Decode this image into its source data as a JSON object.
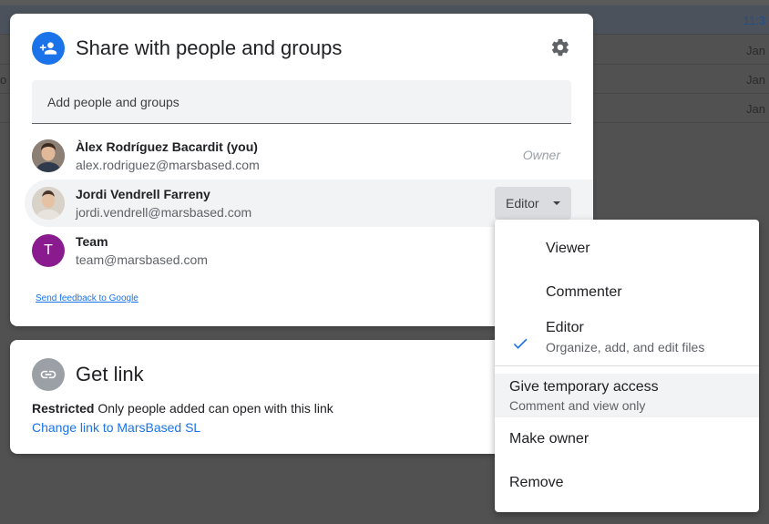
{
  "background": {
    "times": [
      "11:3",
      "Jan",
      "Jan",
      "Jan"
    ],
    "fragments": [
      "",
      "",
      "o (",
      ""
    ]
  },
  "share_dialog": {
    "title": "Share with people and groups",
    "add_placeholder": "Add people and groups",
    "people": [
      {
        "name": "Àlex Rodríguez Bacardit (you)",
        "email": "alex.rodriguez@marsbased.com",
        "role": "Owner"
      },
      {
        "name": "Jordi Vendrell Farreny",
        "email": "jordi.vendrell@marsbased.com",
        "role": "Editor"
      },
      {
        "name": "Team",
        "email": "team@marsbased.com",
        "initial": "T"
      }
    ],
    "feedback_link": "Send feedback to Google"
  },
  "get_link": {
    "title": "Get link",
    "restricted_label": "Restricted",
    "restricted_desc": "Only people added can open with this link",
    "change_link": "Change link to MarsBased SL"
  },
  "role_menu": {
    "items": [
      {
        "label": "Viewer"
      },
      {
        "label": "Commenter"
      },
      {
        "label": "Editor",
        "sub": "Organize, add, and edit files",
        "checked": true
      },
      {
        "label": "Give temporary access",
        "sub": "Comment and view only"
      },
      {
        "label": "Make owner"
      },
      {
        "label": "Remove"
      }
    ]
  },
  "colors": {
    "accent": "#1a73e8",
    "avatar_team": "#8a1b8e",
    "link_icon_bg": "#9aa0a6",
    "overlay": "#515151"
  }
}
